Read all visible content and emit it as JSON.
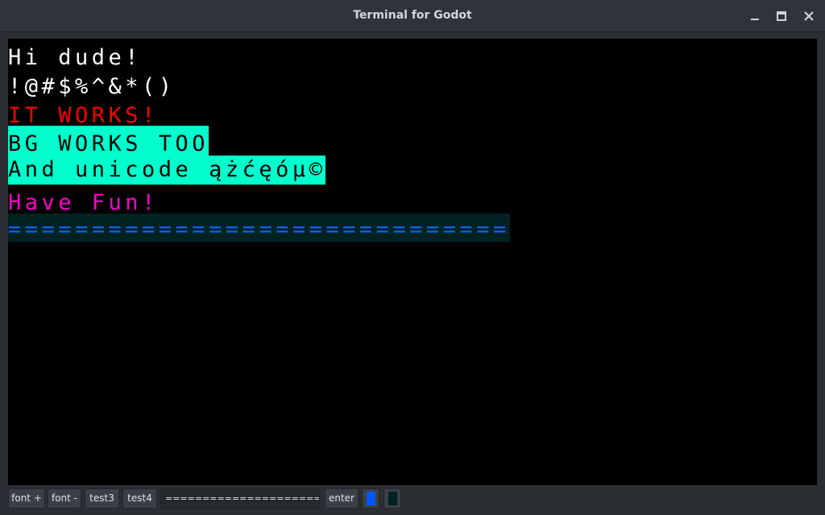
{
  "window": {
    "title": "Terminal for Godot",
    "minimize_icon": "minimize-icon",
    "maximize_icon": "maximize-icon",
    "close_icon": "close-icon"
  },
  "terminal": {
    "background": "#000000",
    "lines": [
      {
        "text": "Hi dude!",
        "fg": "#ffffff",
        "bg": ""
      },
      {
        "text": "!@#$%^&*()",
        "fg": "#ffffff",
        "bg": ""
      },
      {
        "text": "IT WORKS!",
        "fg": "#ff0000",
        "bg": ""
      },
      {
        "text": "BG WORKS TOO",
        "fg": "#000000",
        "bg": "#00ffcc"
      },
      {
        "text": "And unicode ążćęóµ©",
        "fg": "#000000",
        "bg": "#00ffcc"
      },
      {
        "text": "Have Fun!",
        "fg": "#ff00cc",
        "bg": ""
      },
      {
        "text": "==============================",
        "fg": "#0066ff",
        "bg": "#002222"
      }
    ]
  },
  "toolbar": {
    "font_plus": "font +",
    "font_minus": "font -",
    "test3": "test3",
    "test4": "test4",
    "input_value": "========================",
    "enter": "enter",
    "fg_color": "#0055ff",
    "bg_color": "#002222"
  }
}
